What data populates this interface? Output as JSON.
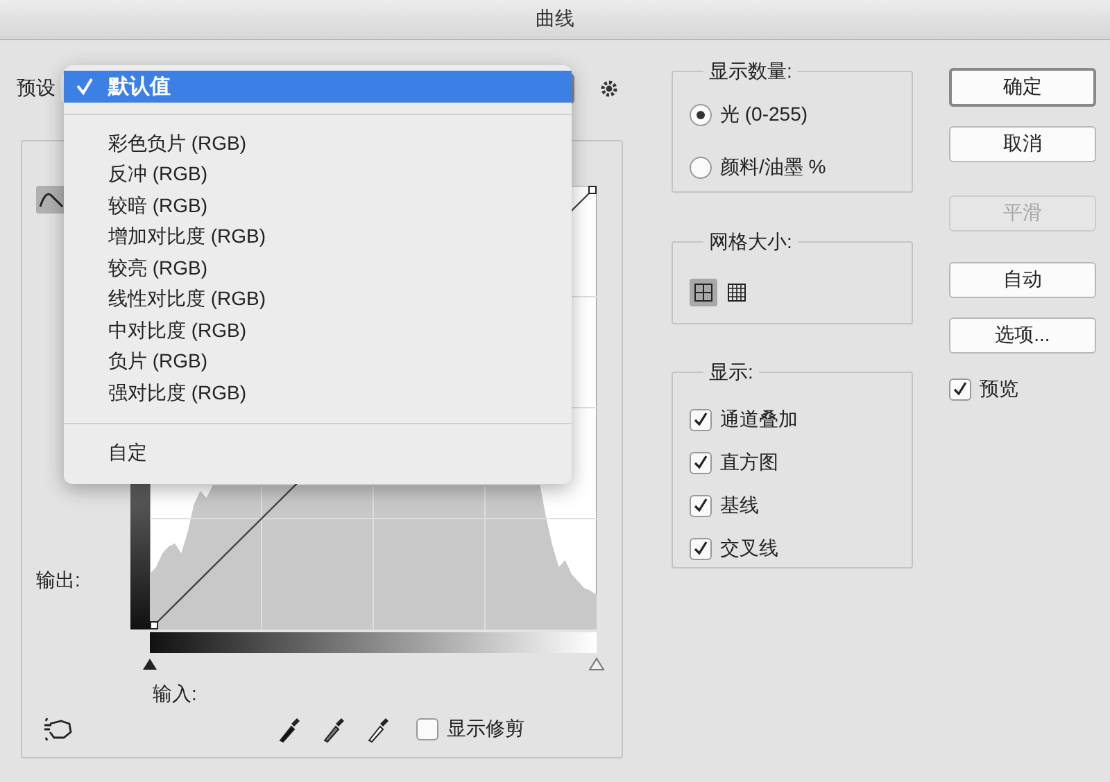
{
  "window": {
    "title": "曲线"
  },
  "preset": {
    "label": "预设",
    "menu_groups": [
      [
        {
          "label": "默认值",
          "selected": true
        }
      ],
      [
        {
          "label": "彩色负片 (RGB)",
          "selected": false
        },
        {
          "label": "反冲 (RGB)",
          "selected": false
        },
        {
          "label": "较暗 (RGB)",
          "selected": false
        },
        {
          "label": "增加对比度 (RGB)",
          "selected": false
        },
        {
          "label": "较亮 (RGB)",
          "selected": false
        },
        {
          "label": "线性对比度 (RGB)",
          "selected": false
        },
        {
          "label": "中对比度 (RGB)",
          "selected": false
        },
        {
          "label": "负片 (RGB)",
          "selected": false
        },
        {
          "label": "强对比度 (RGB)",
          "selected": false
        }
      ],
      [
        {
          "label": "自定",
          "selected": false
        }
      ]
    ]
  },
  "curves": {
    "output_label": "输出:",
    "input_label": "输入:",
    "show_clipping": {
      "label": "显示修剪",
      "checked": false
    }
  },
  "display_amount": {
    "title": "显示数量:",
    "options": [
      {
        "label": "光 (0-255)",
        "selected": true
      },
      {
        "label": "颜料/油墨 %",
        "selected": false
      }
    ]
  },
  "grid_size": {
    "title": "网格大小:",
    "options": [
      {
        "kind": "coarse",
        "selected": true
      },
      {
        "kind": "fine",
        "selected": false
      }
    ]
  },
  "show": {
    "title": "显示:",
    "options": [
      {
        "label": "通道叠加",
        "checked": true
      },
      {
        "label": "直方图",
        "checked": true
      },
      {
        "label": "基线",
        "checked": true
      },
      {
        "label": "交叉线",
        "checked": true
      }
    ]
  },
  "buttons": [
    {
      "label": "确定",
      "default": true,
      "disabled": false
    },
    {
      "label": "取消",
      "default": false,
      "disabled": false
    },
    {
      "label": "平滑",
      "default": false,
      "disabled": true
    },
    {
      "label": "自动",
      "default": false,
      "disabled": false
    },
    {
      "label": "选项...",
      "default": false,
      "disabled": false
    }
  ],
  "preview": {
    "label": "预览",
    "checked": true
  }
}
